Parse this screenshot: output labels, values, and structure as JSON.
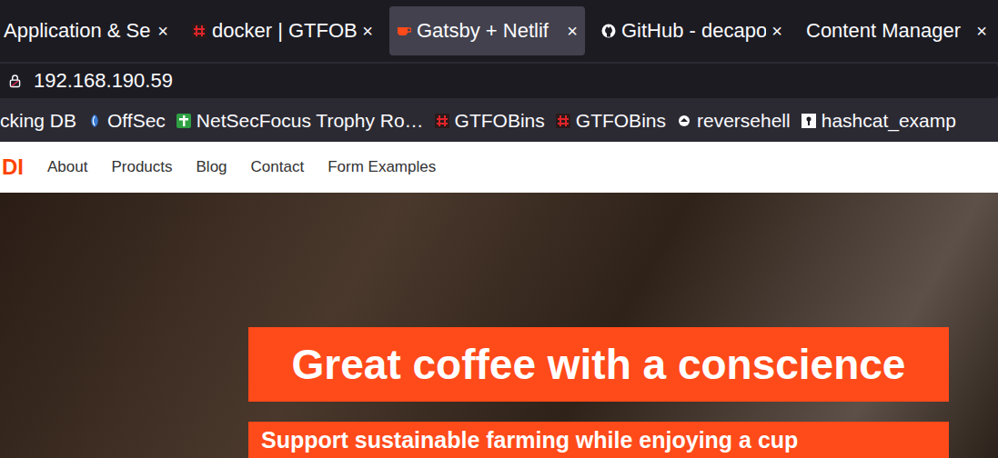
{
  "tabs": [
    {
      "label": "Application & Se",
      "close": "×",
      "kind": "plain",
      "selected": false
    },
    {
      "label": "docker | GTFOB",
      "close": "×",
      "kind": "gtfobins",
      "selected": false
    },
    {
      "label": "Gatsby + Netlif",
      "close": "×",
      "kind": "coffee",
      "selected": true
    },
    {
      "label": "GitHub - decapo",
      "close": "×",
      "kind": "github",
      "selected": false
    },
    {
      "label": "Content Manager",
      "close": "×",
      "kind": "plain",
      "selected": false
    }
  ],
  "url": "192.168.190.59",
  "bookmarks": [
    {
      "label": "cking DB",
      "kind": "plain"
    },
    {
      "label": "OffSec",
      "kind": "offsec"
    },
    {
      "label": "NetSecFocus Trophy Ro…",
      "kind": "netsec"
    },
    {
      "label": "GTFOBins",
      "kind": "gtfobins"
    },
    {
      "label": "GTFOBins",
      "kind": "gtfobins"
    },
    {
      "label": "reversehell",
      "kind": "reverse"
    },
    {
      "label": "hashcat_examp",
      "kind": "hashcat"
    }
  ],
  "site": {
    "logo": "DI",
    "nav": [
      "About",
      "Products",
      "Blog",
      "Contact",
      "Form Examples"
    ],
    "hero": {
      "title": "Great coffee with a conscience",
      "subtitle": "Support sustainable farming while enjoying a cup"
    }
  }
}
